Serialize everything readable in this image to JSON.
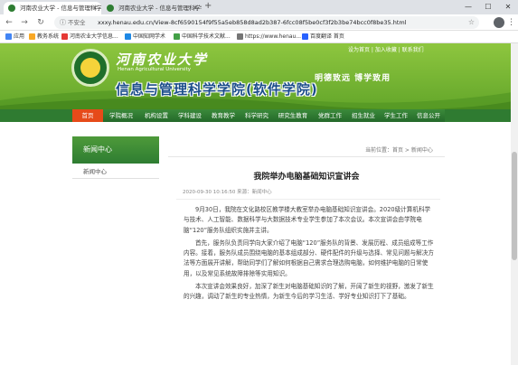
{
  "browser": {
    "tabs": [
      {
        "title": "河南农业大学 - 信息与管理科学学院"
      },
      {
        "title": "河南农业大学 - 信息与管理科学学院"
      }
    ],
    "url": "xxxy.henau.edu.cn/View-8cf6590154f9f55a5eb858d8ad2b387-6fcc08f5be0cf3f2b3be74bcc0f8be35.html",
    "secure_label": "不安全",
    "bookmarks": [
      "应用",
      "教务系统",
      "河南农业大学信息...",
      "中国知网学术",
      "中国科学技术文献...",
      "https://www.henau...",
      "百度翻译 首页"
    ]
  },
  "header": {
    "university_name": "河南农业大学",
    "university_en": "Henan Agricultural University",
    "college_name": "信息与管理科学学院(软件学院)",
    "motto": "明德致远 博学致用",
    "top_links": "设为首页 | 加入收藏 | 联系我们"
  },
  "nav": {
    "items": [
      "首页",
      "学院概况",
      "机构设置",
      "学科建设",
      "教育教学",
      "科学研究",
      "研究生教育",
      "党群工作",
      "招生就业",
      "学生工作",
      "信息公开"
    ]
  },
  "sidebar": {
    "title": "新闻中心",
    "items": [
      "新闻中心"
    ]
  },
  "breadcrumb": "当前位置：首页 > 新闻中心",
  "article": {
    "title": "我院举办电脑基础知识宣讲会",
    "meta": "2020-09-30 10:16:50  来源：新闻中心",
    "paragraphs": [
      "9月30日，我院在文化路校区教学楼大教室举办电脑基础知识宣讲会。2020级计算机科学与技术、人工智能、数据科学与大数据技术专业学生参加了本次会议。本次宣讲会由学院电脑“120”服务队组织实施并主讲。",
      "首先，服务队负责同学向大家介绍了电脑“120”服务队的背景、发展历程、成员组成等工作内容。接着，服务队成员围绕电脑的基本组成部分、硬件配件的升级与选择、常见问题与解决方法等方面展开讲解，帮助同学们了解如何根据自己需求合理选购电脑，如何维护电脑的日常使用，以及常见系统故障排除等实用知识。",
      "本次宣讲会效果良好，加深了新生对电脑基础知识的了解，开阔了新生的视野，激发了新生的兴趣，调动了新生的专业热情，为新生今后的学习生活、学好专业知识打下了基础。"
    ]
  },
  "colors": {
    "header_green": "#63a62a",
    "nav_green": "#24692a",
    "nav_active": "#e64a19",
    "college_blue": "#1b4d8a"
  }
}
